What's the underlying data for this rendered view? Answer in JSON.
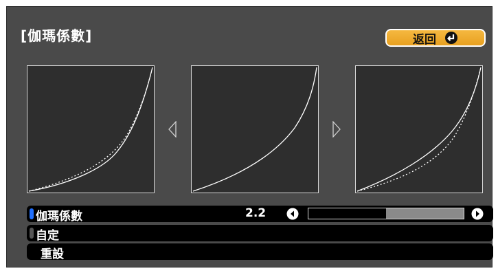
{
  "title": "[伽瑪係數]",
  "back_button": {
    "label": "返回"
  },
  "graphs": [
    {
      "name": "left-gamma-graph",
      "curves": [
        "solid-lower",
        "dotted-reference"
      ]
    },
    {
      "name": "center-gamma-graph",
      "curves": [
        "solid"
      ]
    },
    {
      "name": "right-gamma-graph",
      "curves": [
        "solid-upper",
        "dotted-reference"
      ]
    }
  ],
  "menu": {
    "items": [
      {
        "label": "伽瑪係數",
        "value": "2.2",
        "indicator_color": "#1f6fff"
      },
      {
        "label": "自定",
        "indicator_color": "#555555"
      },
      {
        "label": "重設"
      }
    ]
  },
  "slider": {
    "level_fraction": 0.5
  }
}
